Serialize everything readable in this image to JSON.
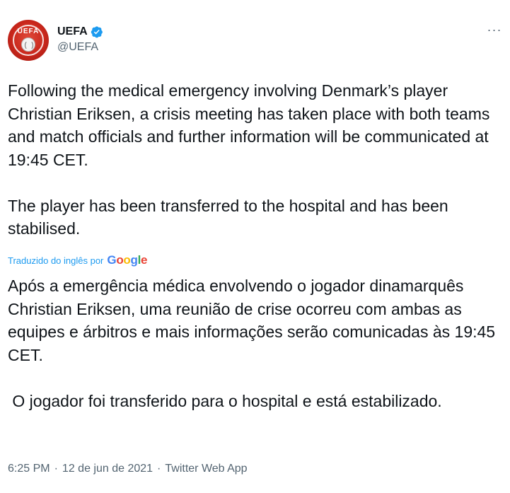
{
  "account": {
    "display_name": "UEFA",
    "handle": "@UEFA",
    "avatar_text": "UEFA",
    "verified_color": "#1d9bf0",
    "avatar_color": "#c8261b"
  },
  "menu": {
    "icon": "more-horizontal-icon",
    "glyph": "···"
  },
  "tweet": {
    "original_text": "Following the medical emergency involving Denmark’s player Christian Eriksen, a crisis meeting has taken place with both teams and match officials and further information will be communicated at 19:45 CET.\n\nThe player has been transferred to the hospital and has been stabilised.",
    "translated_by_label": "Traduzido do inglês por",
    "translation_provider": {
      "G": "G",
      "o1": "o",
      "o2": "o",
      "g": "g",
      "l": "l",
      "e": "e"
    },
    "translated_text": "Após a emergência médica envolvendo o jogador dinamarquês Christian Eriksen, uma reunião de crise ocorreu com ambas as equipes e árbitros e mais informações serão comunicadas às 19:45 CET.\n\n O jogador foi transferido para o hospital e está estabilizado."
  },
  "meta": {
    "time": "6:25 PM",
    "separator": "·",
    "date": "12 de jun de 2021",
    "source": "Twitter Web App"
  }
}
